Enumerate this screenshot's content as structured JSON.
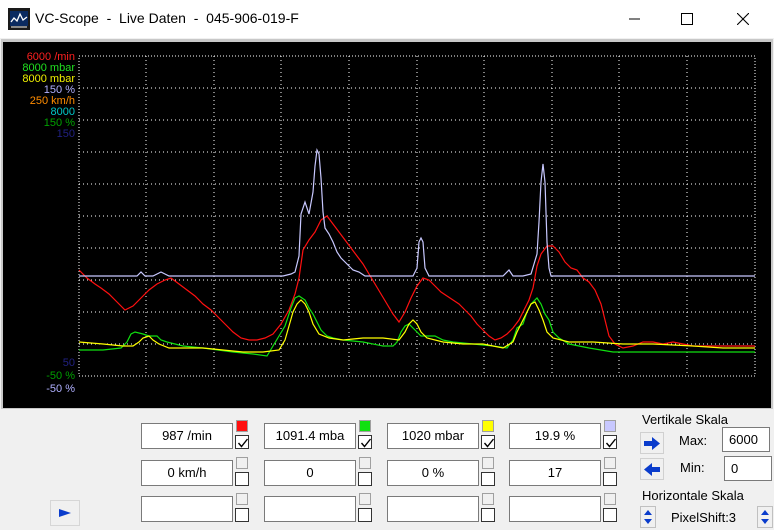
{
  "window": {
    "title": "VC-Scope  -  Live Daten  -  045-906-019-F"
  },
  "scale_labels_top": [
    {
      "text": "6000 /min",
      "color": "#ff2020"
    },
    {
      "text": "8000 mbar",
      "color": "#20e020"
    },
    {
      "text": "8000 mbar",
      "color": "#f0f000"
    },
    {
      "text": "150 %",
      "color": "#b0b0ff"
    },
    {
      "text": "250 km/h",
      "color": "#ff8c00"
    },
    {
      "text": "8000",
      "color": "#00c8c8"
    },
    {
      "text": "150 %",
      "color": "#00a000"
    },
    {
      "text": "150",
      "color": "#202080"
    }
  ],
  "scale_labels_bottom": [
    {
      "text": "50",
      "color": "#202080"
    },
    {
      "text": "-50 %",
      "color": "#00a000"
    },
    {
      "text": "-50 %",
      "color": "#b0b0ff"
    }
  ],
  "channels": [
    {
      "value": "987 /min",
      "swatch": "#ff1010",
      "checked": true
    },
    {
      "value": "1091.4 mba",
      "swatch": "#10e010",
      "checked": true
    },
    {
      "value": "1020 mbar",
      "swatch": "#ffff00",
      "checked": true
    },
    {
      "value": "19.9 %",
      "swatch": "#c8c8ff",
      "checked": true
    },
    {
      "value": "0 km/h",
      "swatch": "#f0f0f0",
      "checked": false
    },
    {
      "value": "0",
      "swatch": "#f0f0f0",
      "checked": false
    },
    {
      "value": "0 %",
      "swatch": "#f0f0f0",
      "checked": false
    },
    {
      "value": "17",
      "swatch": "#f0f0f0",
      "checked": false
    },
    {
      "value": "",
      "swatch": "#f0f0f0",
      "checked": false
    },
    {
      "value": "",
      "swatch": "#f0f0f0",
      "checked": false
    },
    {
      "value": "",
      "swatch": "#f0f0f0",
      "checked": false
    },
    {
      "value": "",
      "swatch": "#f0f0f0",
      "checked": false
    }
  ],
  "vertical_scale": {
    "label": "Vertikale Skala",
    "max_label": "Max:",
    "max_value": "6000",
    "min_label": "Min:",
    "min_value": "0"
  },
  "horizontal_scale": {
    "label": "Horizontale Skala",
    "pixelshift": "PixelShift:3"
  },
  "colors": {
    "accent_blue": "#0a3ccc",
    "trace_red": "#ff1010",
    "trace_green": "#10e010",
    "trace_yellow": "#ffff00",
    "trace_lavender": "#c8c8ff"
  }
}
